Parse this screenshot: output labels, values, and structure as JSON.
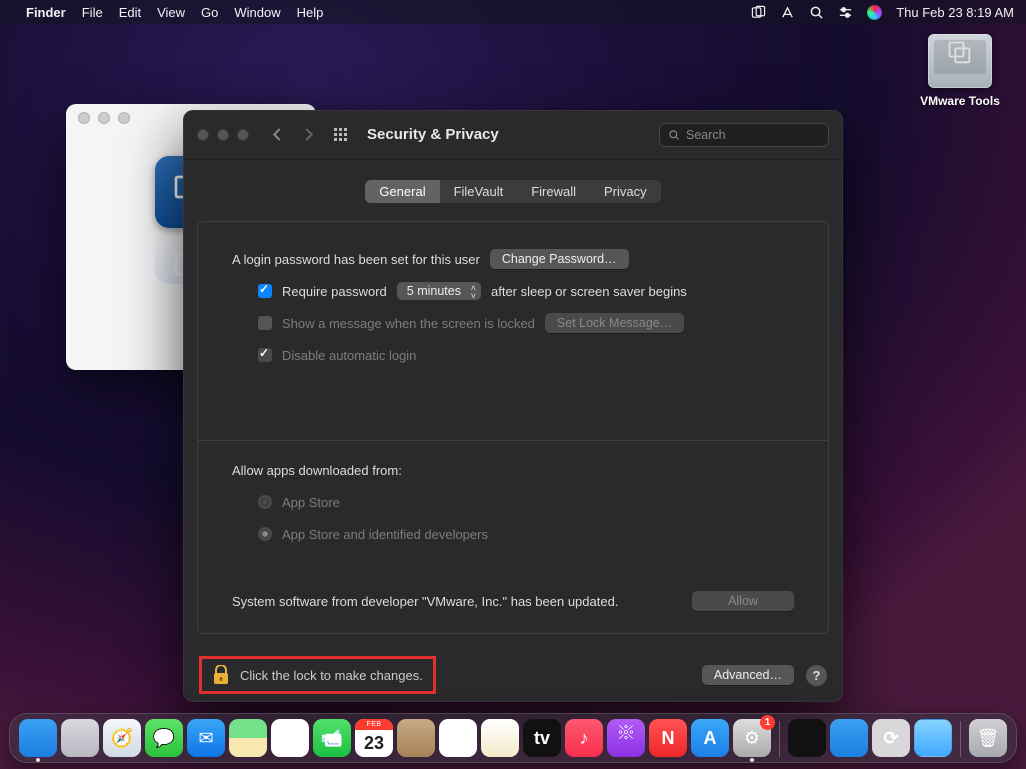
{
  "menubar": {
    "app": "Finder",
    "items": [
      "File",
      "Edit",
      "View",
      "Go",
      "Window",
      "Help"
    ],
    "datetime": "Thu Feb 23  8:19 AM"
  },
  "desktop": {
    "vmware_label": "VMware Tools"
  },
  "prefs": {
    "title": "Security & Privacy",
    "search_placeholder": "Search",
    "tabs": [
      "General",
      "FileVault",
      "Firewall",
      "Privacy"
    ],
    "login_pw_text": "A login password has been set for this user",
    "change_pw_btn": "Change Password…",
    "require_pw_label": "Require password",
    "require_pw_delay": "5 minutes",
    "require_pw_suffix": "after sleep or screen saver begins",
    "show_msg_label": "Show a message when the screen is locked",
    "set_lock_btn": "Set Lock Message…",
    "disable_auto_label": "Disable automatic login",
    "allow_apps_label": "Allow apps downloaded from:",
    "radio_appstore": "App Store",
    "radio_identified": "App Store and identified developers",
    "system_software_text": "System software from developer \"VMware, Inc.\" has been updated.",
    "allow_btn": "Allow",
    "lock_text": "Click the lock to make changes.",
    "advanced_btn": "Advanced…"
  },
  "calendar": {
    "month": "FEB",
    "day": "23"
  },
  "dock": {
    "badge_settings": "1"
  }
}
